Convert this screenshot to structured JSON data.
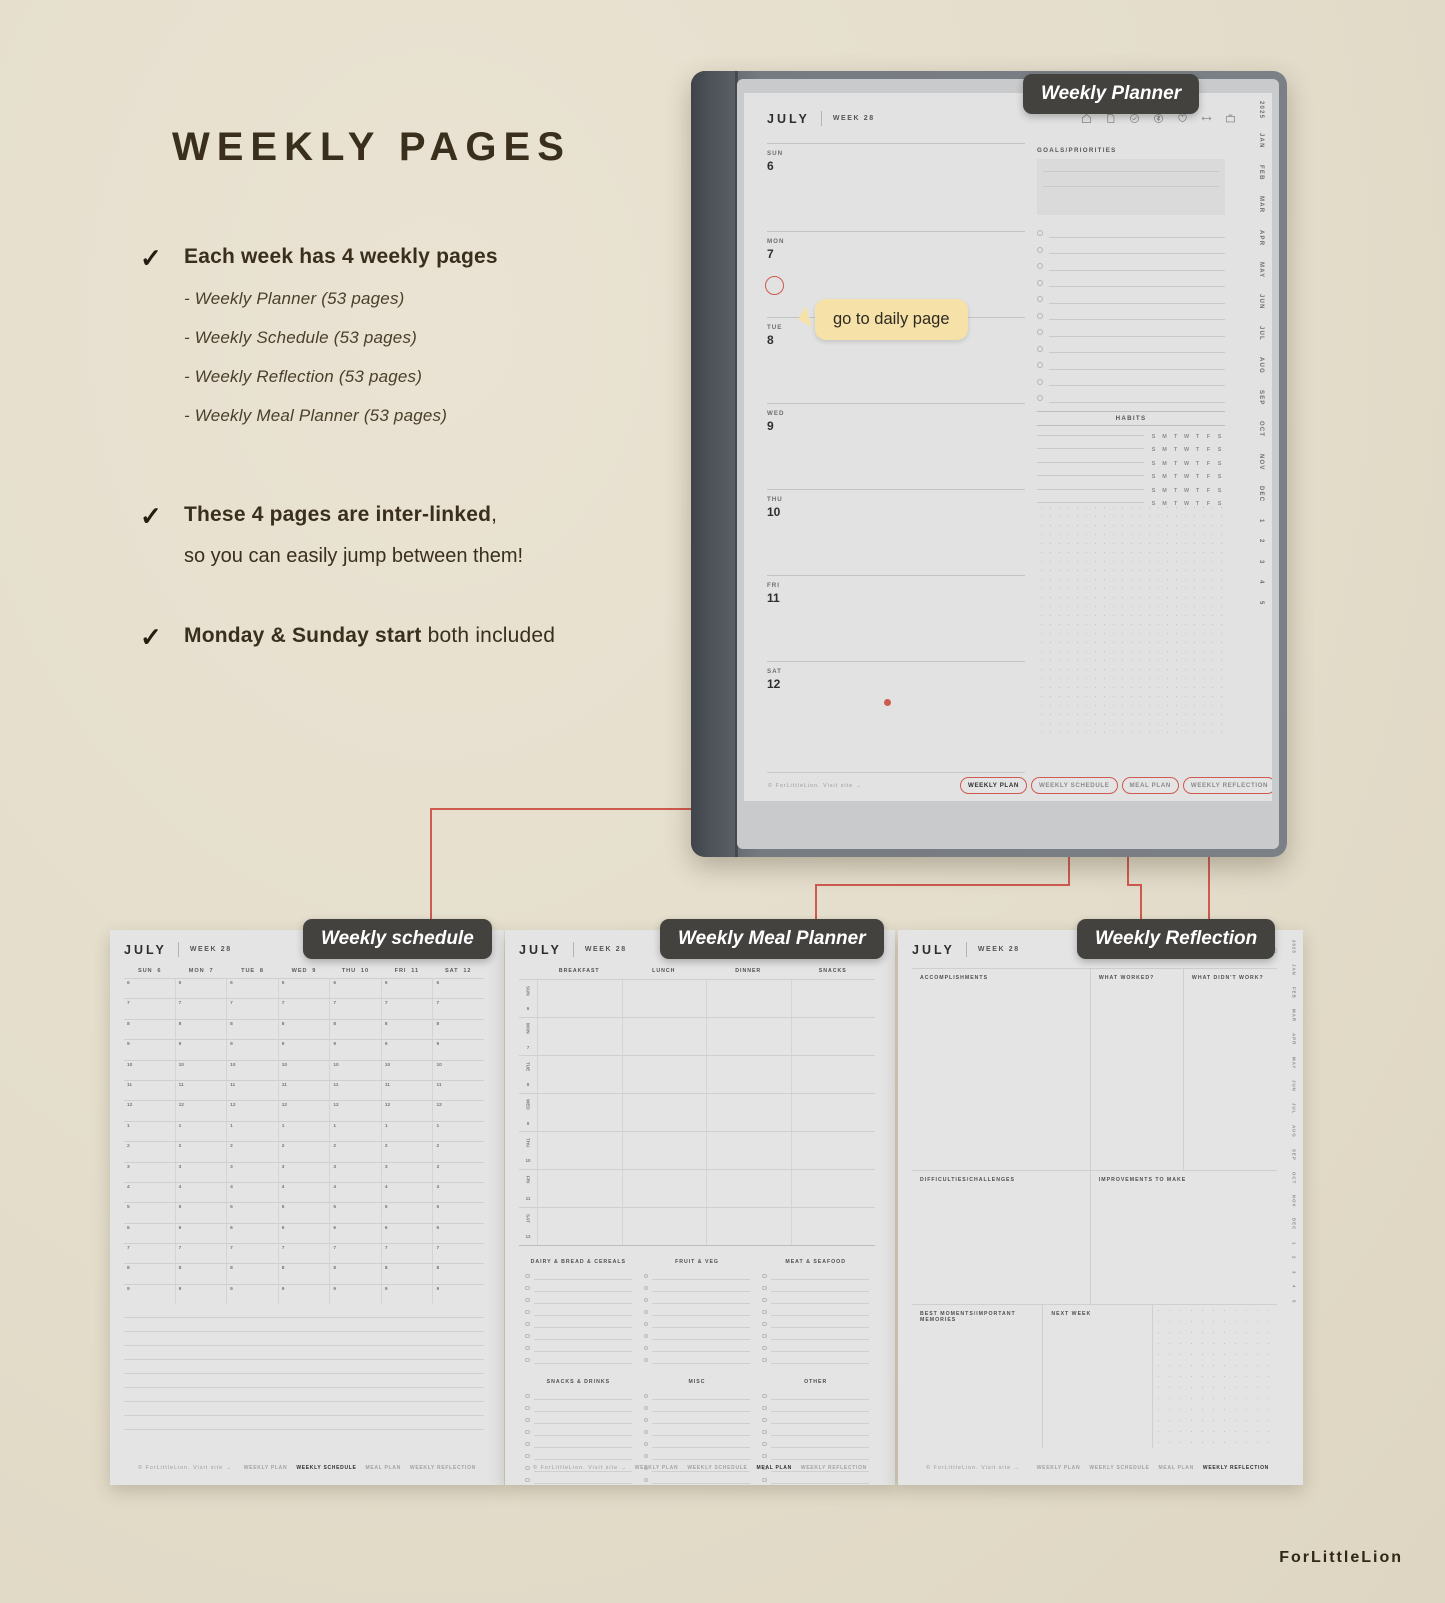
{
  "headline": "WEEKLY PAGES",
  "bullets": [
    {
      "text": "Each week has 4 weekly pages",
      "sub": [
        "- Weekly Planner (53 pages)",
        "- Weekly Schedule (53 pages)",
        "- Weekly Reflection (53 pages)",
        "- Weekly Meal Planner (53 pages)"
      ]
    },
    {
      "bold": "These 4 pages are inter-linked",
      "tail": ",",
      "second_line": "so you can easily jump between them!"
    },
    {
      "bold": "Monday & Sunday start",
      "tail": " both included"
    }
  ],
  "callouts": {
    "planner": "Weekly Planner",
    "schedule": "Weekly schedule",
    "meal": "Weekly Meal Planner",
    "reflection": "Weekly Reflection"
  },
  "tooltip": "go to daily page",
  "brand": "ForLittleLion",
  "planner": {
    "month": "JULY",
    "week": "WEEK 28",
    "icons": [
      "home-icon",
      "page-icon",
      "check-circle-icon",
      "dollar-circle-icon",
      "heart-icon",
      "arrows-icon",
      "briefcase-icon"
    ],
    "days": [
      {
        "label": "SUN",
        "num": "6"
      },
      {
        "label": "MON",
        "num": "7"
      },
      {
        "label": "TUE",
        "num": "8"
      },
      {
        "label": "WED",
        "num": "9"
      },
      {
        "label": "THU",
        "num": "10"
      },
      {
        "label": "FRI",
        "num": "11"
      },
      {
        "label": "SAT",
        "num": "12"
      }
    ],
    "goals_title": "GOALS/PRIORITIES",
    "habits_title": "HABITS",
    "habit_days": [
      "S",
      "M",
      "T",
      "W",
      "T",
      "F",
      "S"
    ],
    "habit_rows": 6,
    "todo_rows": 11,
    "footer": "© ForLittleLion.    Visit site →",
    "nav": [
      "WEEKLY PLAN",
      "WEEKLY SCHEDULE",
      "MEAL PLAN",
      "WEEKLY REFLECTION"
    ],
    "nav_active": "WEEKLY PLAN",
    "month_tabs": [
      "2025",
      "JAN",
      "FEB",
      "MAR",
      "APR",
      "MAY",
      "JUN",
      "JUL",
      "AUG",
      "SEP",
      "OCT",
      "NOV",
      "DEC",
      "1",
      "2",
      "3",
      "4",
      "5"
    ]
  },
  "schedule": {
    "month": "JULY",
    "week": "WEEK 28",
    "columns": [
      {
        "label": "SUN",
        "num": "6"
      },
      {
        "label": "MON",
        "num": "7"
      },
      {
        "label": "TUE",
        "num": "8"
      },
      {
        "label": "WED",
        "num": "9"
      },
      {
        "label": "THU",
        "num": "10"
      },
      {
        "label": "FRI",
        "num": "11"
      },
      {
        "label": "SAT",
        "num": "12"
      }
    ],
    "hours": [
      "6",
      "7",
      "8",
      "9",
      "10",
      "11",
      "12",
      "1",
      "2",
      "3",
      "4",
      "5",
      "6",
      "7",
      "8",
      "9"
    ],
    "notes_rows": 9,
    "footer": "© ForLittleLion.   Visit site →",
    "nav": [
      "WEEKLY PLAN",
      "WEEKLY SCHEDULE",
      "MEAL PLAN",
      "WEEKLY REFLECTION"
    ],
    "nav_active": "WEEKLY SCHEDULE"
  },
  "meal": {
    "month": "JULY",
    "week": "WEEK 28",
    "columns": [
      "BREAKFAST",
      "LUNCH",
      "DINNER",
      "SNACKS"
    ],
    "rows": [
      {
        "label": "SUN",
        "num": "6"
      },
      {
        "label": "MON",
        "num": "7"
      },
      {
        "label": "TUE",
        "num": "8"
      },
      {
        "label": "WED",
        "num": "9"
      },
      {
        "label": "THU",
        "num": "10"
      },
      {
        "label": "FRI",
        "num": "11"
      },
      {
        "label": "SAT",
        "num": "12"
      }
    ],
    "lists": [
      "DAIRY & BREAD & CEREALS",
      "FRUIT & VEG",
      "MEAT & SEAFOOD",
      "SNACKS & DRINKS",
      "MISC",
      "OTHER"
    ],
    "list_rows": 8,
    "footer": "© ForLittleLion.   Visit site →",
    "nav": [
      "WEEKLY PLAN",
      "WEEKLY SCHEDULE",
      "MEAL PLAN",
      "WEEKLY REFLECTION"
    ],
    "nav_active": "MEAL PLAN"
  },
  "reflection": {
    "month": "JULY",
    "week": "WEEK 28",
    "sections": {
      "accomplishments": "ACCOMPLISHMENTS",
      "what_worked": "WHAT WORKED?",
      "what_didnt": "WHAT DIDN'T WORK?",
      "difficulties": "DIFFICULTIES/CHALLENGES",
      "improvements": "IMPROVEMENTS TO MAKE",
      "best_moments": "BEST MOMENTS/IMPORTANT MEMORIES",
      "next_week": "NEXT WEEK"
    },
    "footer": "© ForLittleLion.   Visit site →",
    "nav": [
      "WEEKLY PLAN",
      "WEEKLY SCHEDULE",
      "MEAL PLAN",
      "WEEKLY REFLECTION"
    ],
    "nav_active": "WEEKLY REFLECTION"
  },
  "colors": {
    "accent": "#cf5a4e",
    "bg": "#e6dfce",
    "ink": "#3a2f1c",
    "callout": "#44423f",
    "tip": "#f6e2a8"
  }
}
